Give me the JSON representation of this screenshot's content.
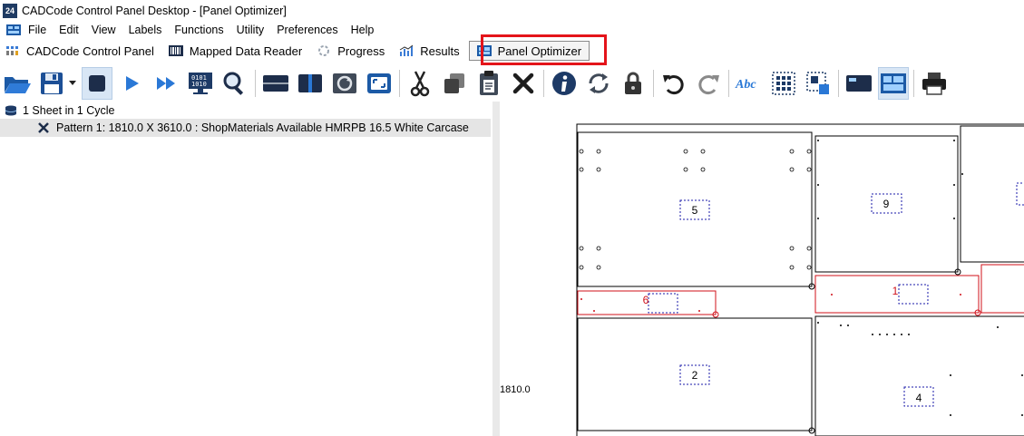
{
  "window": {
    "app_icon_text": "24",
    "title": "CADCode Control Panel Desktop - [Panel Optimizer]"
  },
  "menu": {
    "items": [
      "File",
      "Edit",
      "View",
      "Labels",
      "Functions",
      "Utility",
      "Preferences",
      "Help"
    ]
  },
  "tabs": [
    {
      "label": "CADCode Control Panel",
      "icon": "grid-chart-icon"
    },
    {
      "label": "Mapped Data Reader",
      "icon": "barcode-icon"
    },
    {
      "label": "Progress",
      "icon": "spinner-icon"
    },
    {
      "label": "Results",
      "icon": "bar-chart-icon"
    },
    {
      "label": "Panel Optimizer",
      "icon": "panel-layout-icon",
      "active": true
    }
  ],
  "toolbar": {
    "buttons": [
      "open-folder",
      "save",
      "save-dropdown",
      "stop",
      "run",
      "fast-forward",
      "monitor-binary",
      "search",
      "horizontal-split",
      "vertical-split",
      "refresh-sheet",
      "fit-view",
      "cut",
      "copy",
      "paste",
      "delete",
      "info",
      "refresh",
      "lock",
      "undo",
      "redo",
      "spell-check",
      "select-grid",
      "select-parts",
      "display-card",
      "layout-active",
      "print"
    ]
  },
  "tree": {
    "root_label": "1 Sheet in 1 Cycle",
    "child_label": "Pattern 1: 1810.0 X 3610.0 : ShopMaterials Available HMRPB 16.5 White Carcase"
  },
  "canvas": {
    "dimension_label": "1810.0",
    "part_labels": [
      "5",
      "9",
      "6",
      "1",
      "2",
      "4"
    ],
    "colors": {
      "part_outline": "#000000",
      "offcut_outline": "#d0101a",
      "label_box": "#1a1aa8",
      "highlight": "#e4141a"
    }
  }
}
